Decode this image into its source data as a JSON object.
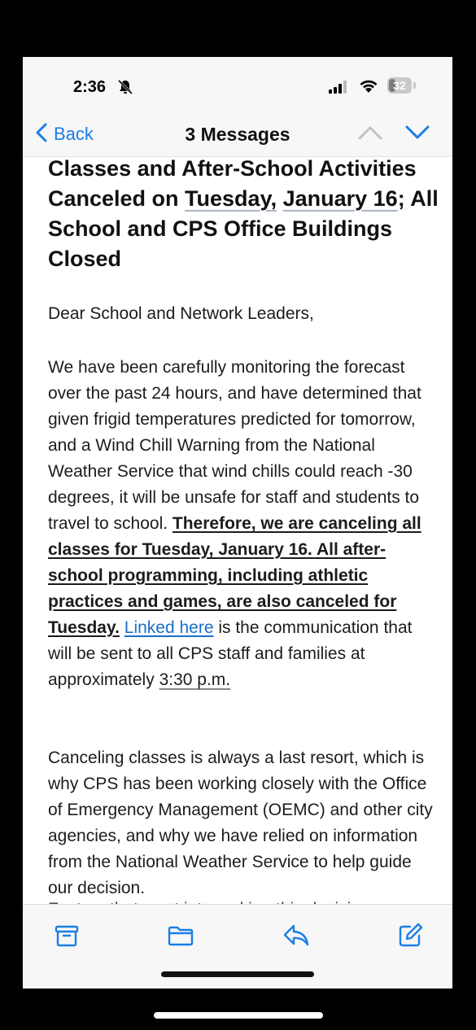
{
  "status": {
    "time": "2:36",
    "battery": "32",
    "battery_level": 0.32
  },
  "nav": {
    "back_label": "Back",
    "title": "3 Messages"
  },
  "email": {
    "subject_1": "Classes and After-School Activities Canceled on ",
    "subject_date_1": "Tuesday,",
    "subject_date_2": "January 16",
    "subject_2": "; All School and CPS Office Buildings Closed",
    "greeting": "Dear School and Network Leaders,",
    "p1_text": "We have been carefully monitoring the forecast over the past 24 hours, and have determined that given frigid temperatures predicted for tomorrow, and a Wind Chill Warning from the National Weather Service that wind chills could reach -30 degrees, it will be unsafe for staff and students to travel to school. ",
    "p1_bold": "Therefore, we are canceling all classes for Tuesday, January 16. All after-school programming, including athletic practices and games, are also canceled for Tuesday.",
    "p1_link": "Linked here",
    "p1_after_link": " is the communication that will be sent to all CPS staff and families at approximately ",
    "p1_time": "3:30 p.m.",
    "p2_text": "Canceling classes is always a last resort, which is why CPS has been working closely with the Office of Emergency Management (OEMC) and other city agencies, and why we have relied on information from the National Weather Service to help guide our decision.",
    "p3_partial": "Factors that went into making this decision"
  }
}
